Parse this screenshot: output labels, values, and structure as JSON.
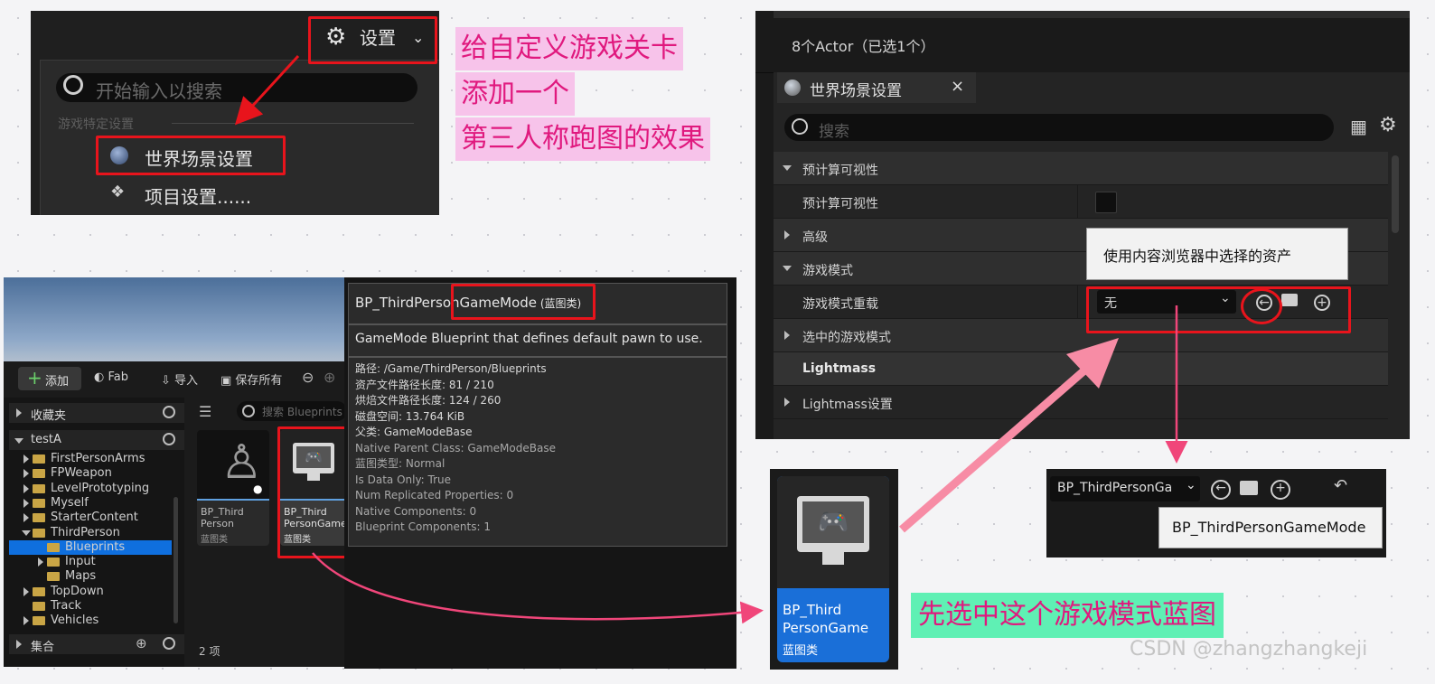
{
  "annotations": {
    "line1": "给自定义游戏关卡",
    "line2": "添加一个",
    "line3": "第三人称跑图的效果",
    "select_hint": "先选中这个游戏模式蓝图",
    "watermark": "CSDN @zhangzhangkeji"
  },
  "settings_menu": {
    "button_label": "设置",
    "search_placeholder": "开始输入以搜索",
    "section": "游戏特定设置",
    "world_settings": "世界场景设置",
    "project_settings": "项目设置......"
  },
  "content_browser": {
    "add": "添加",
    "fab": "Fab",
    "import": "导入",
    "save_all": "保存所有",
    "favorites": "收藏夹",
    "project": "testA",
    "filter_placeholder": "搜索 Blueprints",
    "tree": [
      {
        "label": "FirstPersonArms",
        "depth": 1,
        "state": "collapsed"
      },
      {
        "label": "FPWeapon",
        "depth": 1,
        "state": "collapsed"
      },
      {
        "label": "LevelPrototyping",
        "depth": 1,
        "state": "collapsed"
      },
      {
        "label": "Myself",
        "depth": 1,
        "state": "collapsed"
      },
      {
        "label": "StarterContent",
        "depth": 1,
        "state": "collapsed"
      },
      {
        "label": "ThirdPerson",
        "depth": 1,
        "state": "expanded"
      },
      {
        "label": "Blueprints",
        "depth": 2,
        "state": "selected"
      },
      {
        "label": "Input",
        "depth": 2,
        "state": "collapsed"
      },
      {
        "label": "Maps",
        "depth": 2,
        "state": "none"
      },
      {
        "label": "TopDown",
        "depth": 1,
        "state": "collapsed"
      },
      {
        "label": "Track",
        "depth": 1,
        "state": "none"
      },
      {
        "label": "Vehicles",
        "depth": 1,
        "state": "collapsed"
      }
    ],
    "collections": "集合",
    "item_count": "2 项",
    "asset1_name": "BP_Third Person",
    "asset1_type": "蓝图类",
    "asset2_name": "BP_Third PersonGame",
    "asset2_type": "蓝图类"
  },
  "tooltip": {
    "title_prefix": "BP_ThirdPerson",
    "title_highlight": "GameMode",
    "title_suffix": " (蓝图类)",
    "description": "GameMode Blueprint that defines default pawn to use.",
    "props": [
      "路径: /Game/ThirdPerson/Blueprints",
      "资产文件路径长度: 81 / 210",
      "烘焙文件路径长度: 124 / 260",
      "磁盘空间: 13.764 KiB",
      "父类: GameModeBase",
      "Native Parent Class: GameModeBase",
      "蓝图类型: Normal",
      "Is Data Only: True",
      "Num Replicated Properties: 0",
      "Native Components: 0",
      "Blueprint Components: 1"
    ]
  },
  "details": {
    "actor_count": "8个Actor（已选1个）",
    "tab": "世界场景设置",
    "search_placeholder": "搜索",
    "cat_precomputed": "预计算可视性",
    "prop_precomputed": "预计算可视性",
    "cat_advanced": "高级",
    "cat_gamemode": "游戏模式",
    "prop_override": "游戏模式重载",
    "override_value": "无",
    "selected_gamemode": "选中的游戏模式",
    "cat_lightmass": "Lightmass",
    "lightmass_settings": "Lightmass设置",
    "use_selected_tooltip": "使用内容浏览器中选择的资产"
  },
  "big_asset": {
    "name": "BP_Third PersonGame",
    "type": "蓝图类"
  },
  "result": {
    "value": "BP_ThirdPersonGa",
    "tooltip": "BP_ThirdPersonGameMode"
  }
}
